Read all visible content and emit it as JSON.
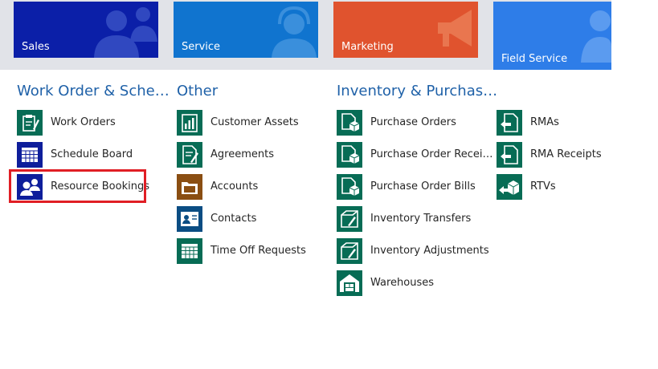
{
  "tiles": {
    "sales": "Sales",
    "service": "Service",
    "marketing": "Marketing",
    "field_service": "Field Service"
  },
  "columns": {
    "work_order": {
      "title": "Work Order & Sche…",
      "items": [
        "Work Orders",
        "Schedule Board",
        "Resource Bookings"
      ]
    },
    "other": {
      "title": "Other",
      "items": [
        "Customer Assets",
        "Agreements",
        "Accounts",
        "Contacts",
        "Time Off Requests"
      ]
    },
    "inventory": {
      "title": "Inventory & Purchas…",
      "items": [
        "Purchase Orders",
        "Purchase Order Recei…",
        "Purchase Order Bills",
        "Inventory Transfers",
        "Inventory Adjustments",
        "Warehouses"
      ]
    },
    "returns": {
      "items": [
        "RMAs",
        "RMA Receipts",
        "RTVs"
      ]
    }
  },
  "colors": {
    "teal_icon": "#076c55",
    "blue_icon": "#0e1e9b",
    "brown_icon": "#8a4e12",
    "heading": "#1f61a8",
    "highlight": "#e01e25"
  }
}
